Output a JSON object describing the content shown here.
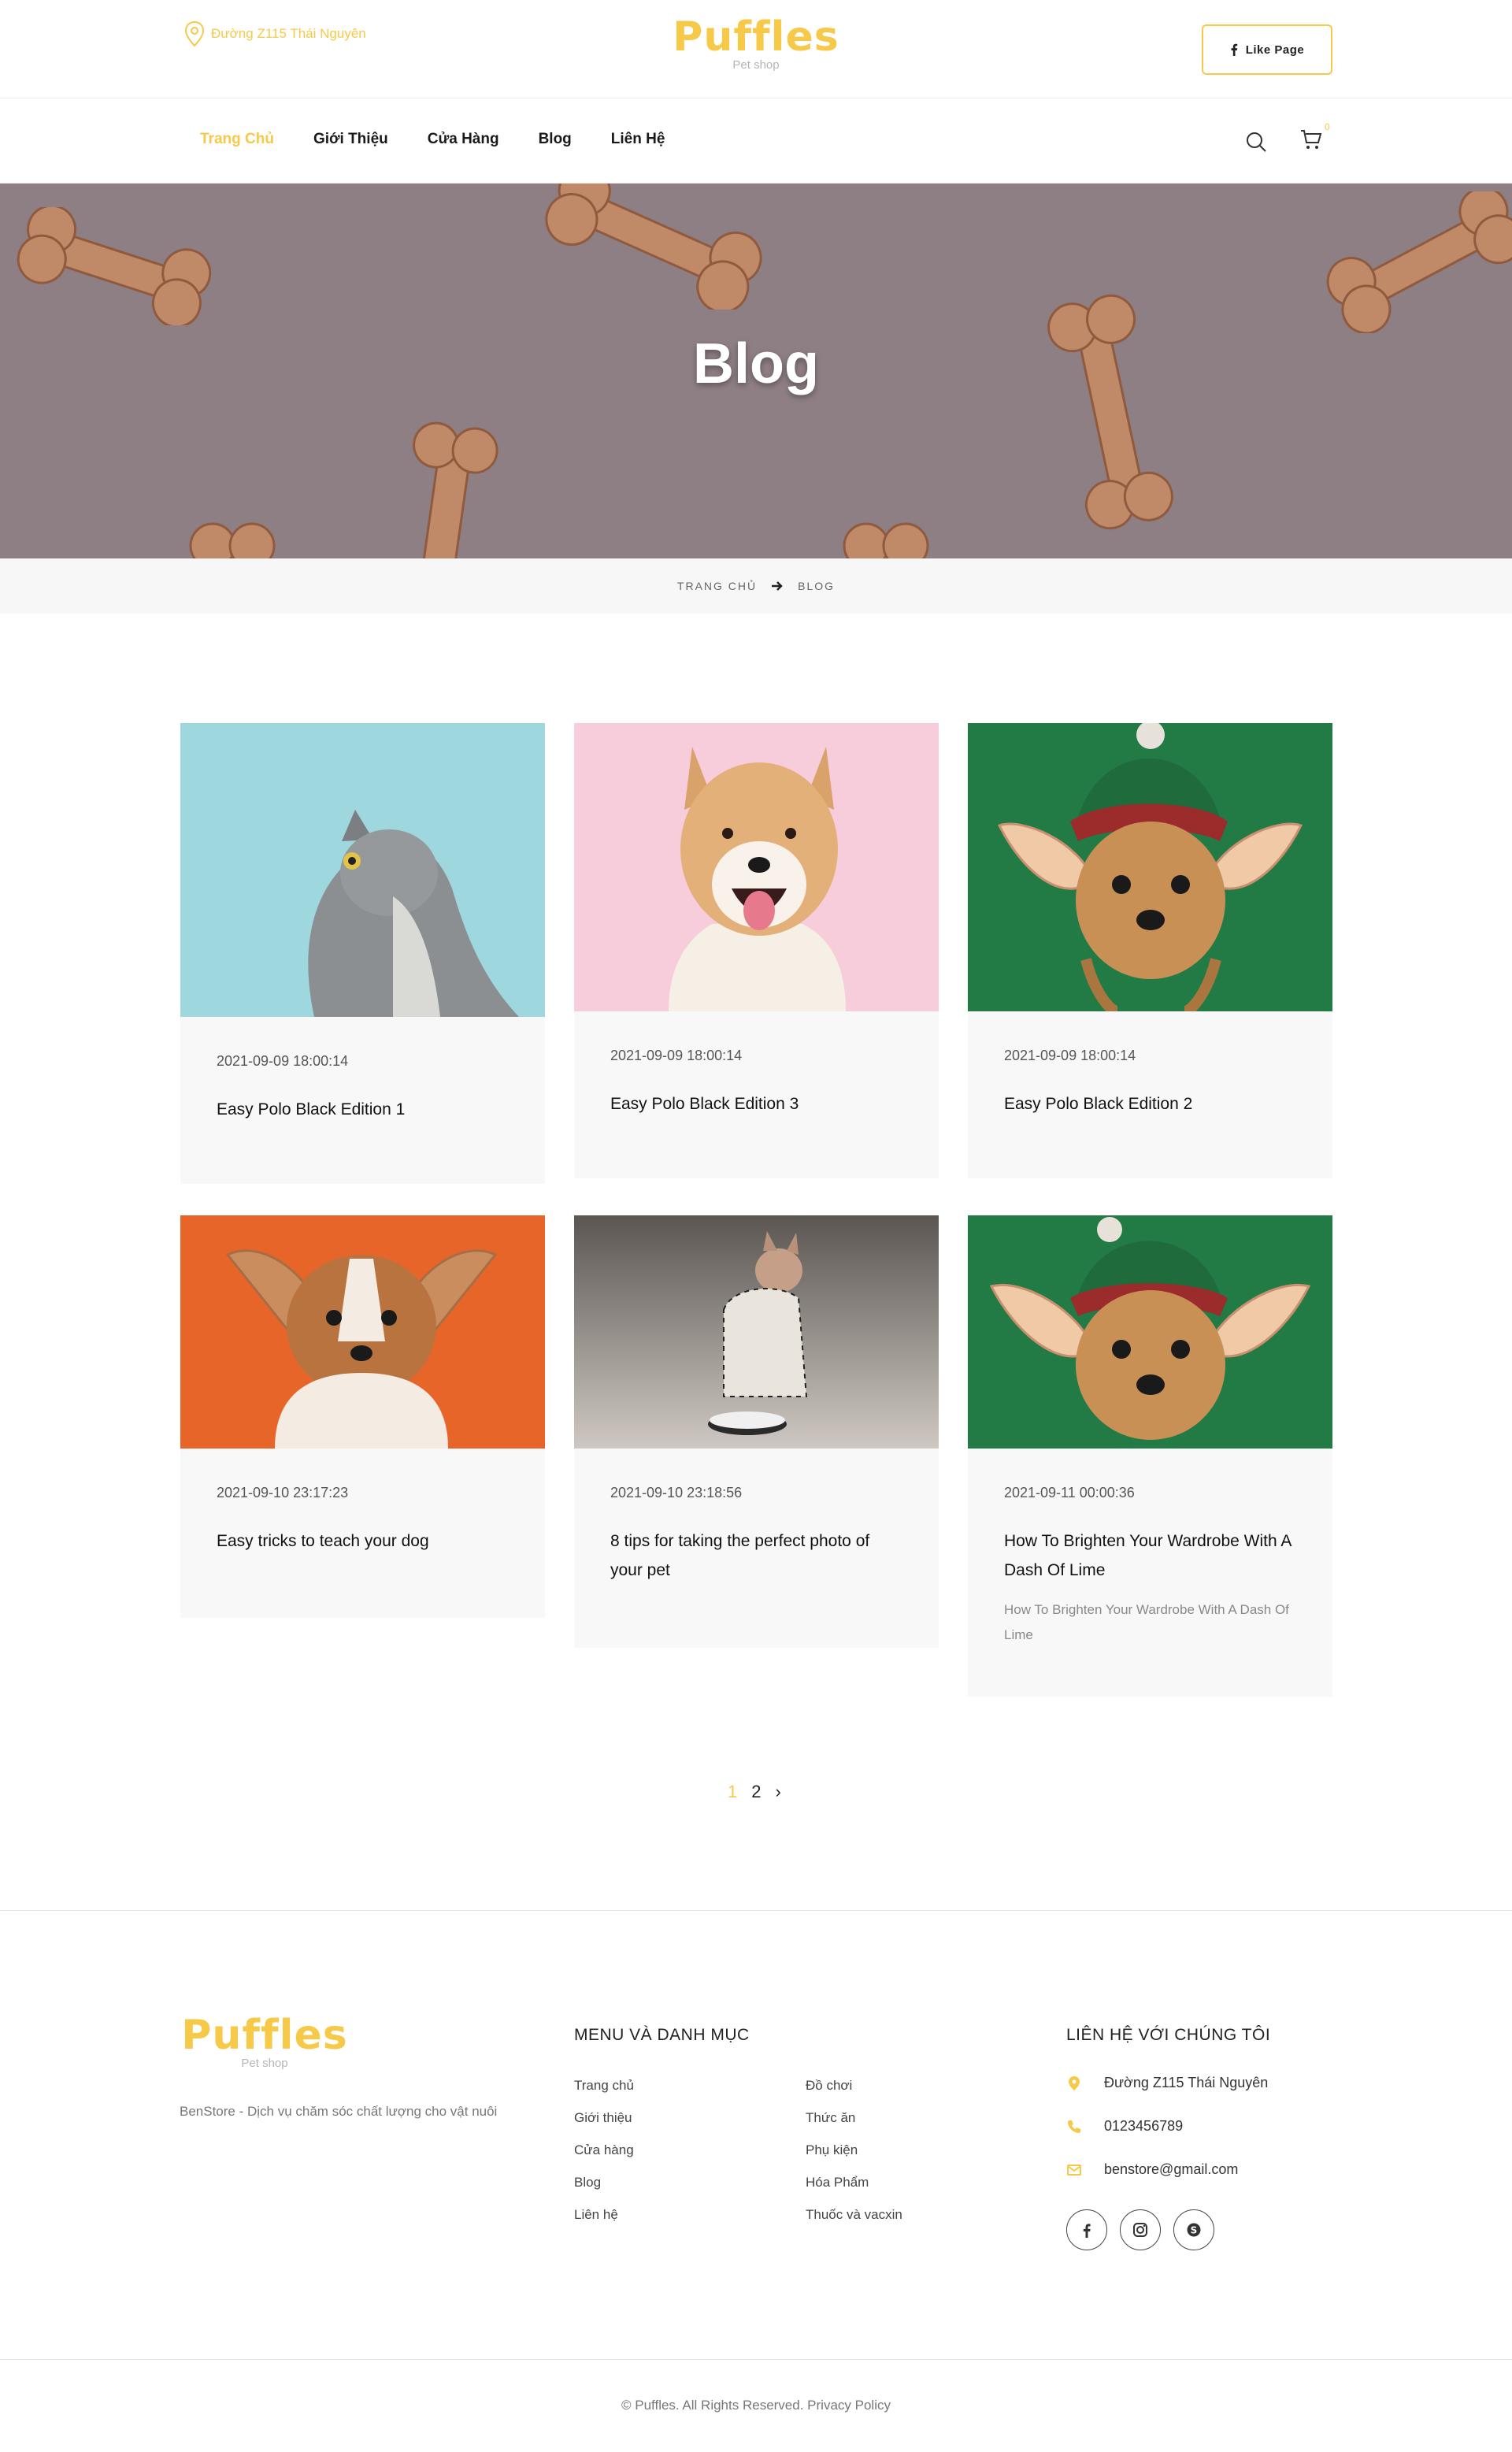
{
  "header": {
    "address": "Đường Z115 Thái Nguyên",
    "logo": "Puffles",
    "logo_sub": "Pet shop",
    "like_label": "Like Page"
  },
  "nav": {
    "items": [
      {
        "label": "Trang Chủ",
        "active": true
      },
      {
        "label": "Giới Thiệu"
      },
      {
        "label": "Cửa Hàng"
      },
      {
        "label": "Blog"
      },
      {
        "label": "Liên Hệ"
      }
    ],
    "cart_count": "0"
  },
  "hero": {
    "title": "Blog"
  },
  "breadcrumb": {
    "home": "TRANG CHỦ",
    "current": "BLOG"
  },
  "posts": [
    {
      "date": "2021-09-09 18:00:14",
      "title": "Easy Polo Black Edition 1",
      "image": "grey cat on blue background"
    },
    {
      "date": "2021-09-09 18:00:14",
      "title": "Easy Polo Black Edition 3",
      "image": "shiba inu on pink background"
    },
    {
      "date": "2021-09-09 18:00:14",
      "title": "Easy Polo Black Edition 2",
      "image": "yorkie with elf hat on green background"
    },
    {
      "date": "2021-09-10 23:17:23",
      "title": "Easy tricks to teach your dog",
      "image": "corgi puppy on orange background"
    },
    {
      "date": "2021-09-10 23:18:56",
      "title": "8 tips for taking the perfect photo of your pet",
      "image": "sphynx cat with houndstooth jacket"
    },
    {
      "date": "2021-09-11 00:00:36",
      "title": "How To Brighten Your Wardrobe With A Dash Of Lime",
      "excerpt": "How To Brighten Your Wardrobe With A Dash Of Lime",
      "image": "yorkie with elf hat on green background"
    }
  ],
  "pagination": {
    "current": "1",
    "next_page": "2",
    "next_arrow": "›"
  },
  "footer": {
    "logo": "Puffles",
    "logo_sub": "Pet shop",
    "tagline": "BenStore - Dịch vụ chăm sóc chất lượng cho vật nuôi",
    "menu_heading": "MENU VÀ DANH MỤC",
    "menu_col1": [
      "Trang chủ",
      "Giới thiệu",
      "Cửa hàng",
      "Blog",
      "Liên hệ"
    ],
    "menu_col2": [
      "Đồ chơi",
      "Thức ăn",
      "Phụ kiện",
      "Hóa Phẩm",
      "Thuốc và vacxin"
    ],
    "contact_heading": "LIÊN HỆ VỚI CHÚNG TÔI",
    "address": "Đường Z115 Thái Nguyên",
    "phone": "0123456789",
    "email": "benstore@gmail.com",
    "social": [
      "facebook-icon",
      "instagram-icon",
      "skype-icon"
    ],
    "copyright": "©  Puffles. All Rights Reserved. Privacy Policy"
  },
  "colors": {
    "accent": "#f7c948",
    "card_bg": "#f8f8f8"
  }
}
